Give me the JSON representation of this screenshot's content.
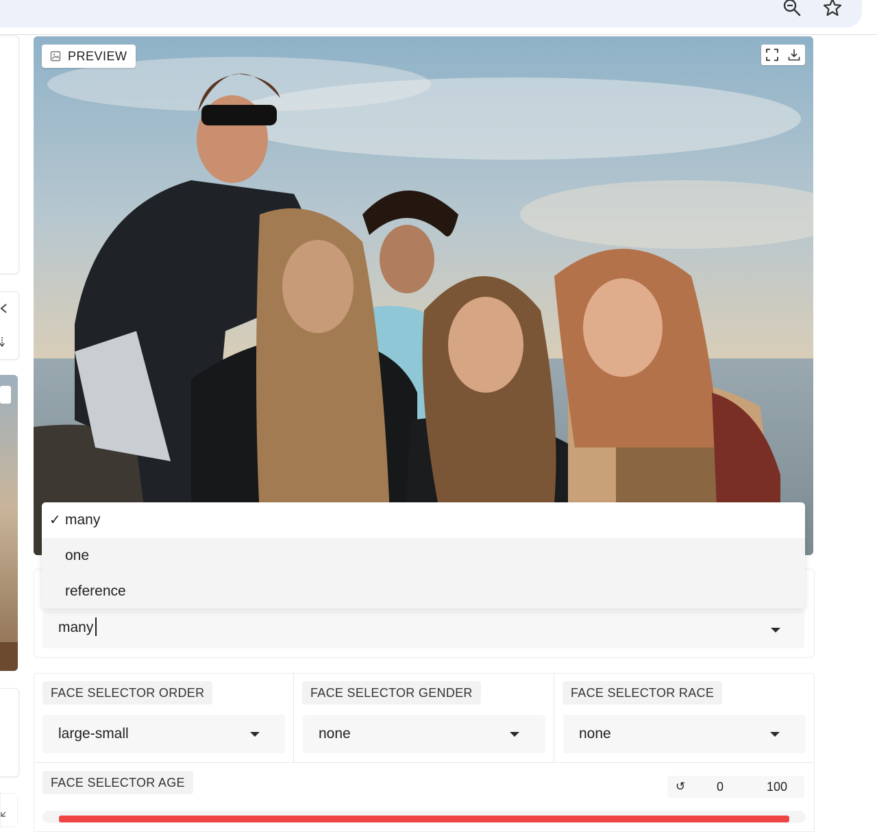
{
  "preview": {
    "badge_label": "PREVIEW"
  },
  "face_selector_mode": {
    "value": "many",
    "options": [
      {
        "label": "many",
        "selected": true,
        "check": "✓"
      },
      {
        "label": "one",
        "selected": false
      },
      {
        "label": "reference",
        "selected": false
      }
    ]
  },
  "face_selector_order": {
    "label": "FACE SELECTOR ORDER",
    "value": "large-small"
  },
  "face_selector_gender": {
    "label": "FACE SELECTOR GENDER",
    "value": "none"
  },
  "face_selector_race": {
    "label": "FACE SELECTOR RACE",
    "value": "none"
  },
  "face_selector_age": {
    "label": "FACE SELECTOR AGE",
    "reset_icon": "↺",
    "min": "0",
    "max": "100",
    "range_fraction": [
      0.0,
      1.0
    ]
  },
  "colors": {
    "accent": "#ef4444",
    "chrome": "#edf2fa"
  },
  "icons": [
    "zoom-out-icon",
    "star-icon",
    "image-icon",
    "fullscreen-icon",
    "download-icon",
    "reset-icon",
    "chevron-down-icon"
  ]
}
